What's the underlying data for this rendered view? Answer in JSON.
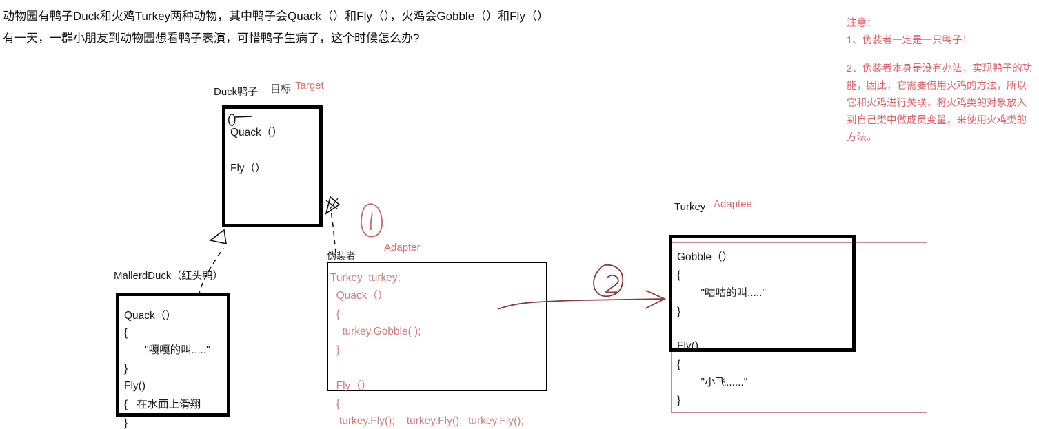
{
  "intro": {
    "line1": "动物园有鸭子Duck和火鸡Turkey两种动物，其中鸭子会Quack（）和Fly（），火鸡会Gobble（）和Fly（）",
    "line2": "有一天，一群小朋友到动物园想看鸭子表演，可惜鸭子生病了，这个时候怎么办?"
  },
  "notes": {
    "title": "注意：",
    "item1": "1、伪装者一定是一只鸭子！",
    "item2": "2、伪装者本身是没有办法，实现鸭子的功能，因此，它需要借用火鸡的方法，所以它和火鸡进行关联，将火鸡类的对象放入到自己类中做成员变量，来使用火鸡类的方法。"
  },
  "duck": {
    "class_label": "Duck鸭子",
    "role_cn": "目标",
    "role_en": "Target",
    "methods": [
      "Quack（）",
      "Fly（）"
    ]
  },
  "mallerd_duck": {
    "class_label": "MallerdDuck（红头鸭）",
    "body": [
      "Quack（）",
      "{",
      "       \"嘎嘎的叫.....\"",
      "}",
      "Fly()",
      "{   在水面上滑翔",
      "}"
    ]
  },
  "adapter": {
    "class_label": "伪装者",
    "role_en": "Adapter",
    "body": [
      "Turkey  turkey;",
      "  Quack（）",
      "  {",
      "    turkey.Gobble( );",
      "  }",
      "",
      "  Fly（）",
      "  {",
      "   turkey.Fly();    turkey.Fly();  turkey.Fly();"
    ]
  },
  "turkey": {
    "class_label": "Turkey",
    "role_en": "Adaptee",
    "body": [
      "Gobble（）",
      "{",
      "        \"咕咕的叫.....\"",
      "}",
      "",
      "Fly()",
      "{",
      "        \"小飞......\"",
      "}"
    ]
  },
  "markers": {
    "one": "1",
    "two": "2"
  },
  "colors": {
    "note_red": "#e0616a",
    "role_red": "#d9706e",
    "code_red": "#cf7d7d",
    "arrow_red": "#8a3a3a",
    "box_black": "#000000",
    "box_red": "#c58a92"
  }
}
